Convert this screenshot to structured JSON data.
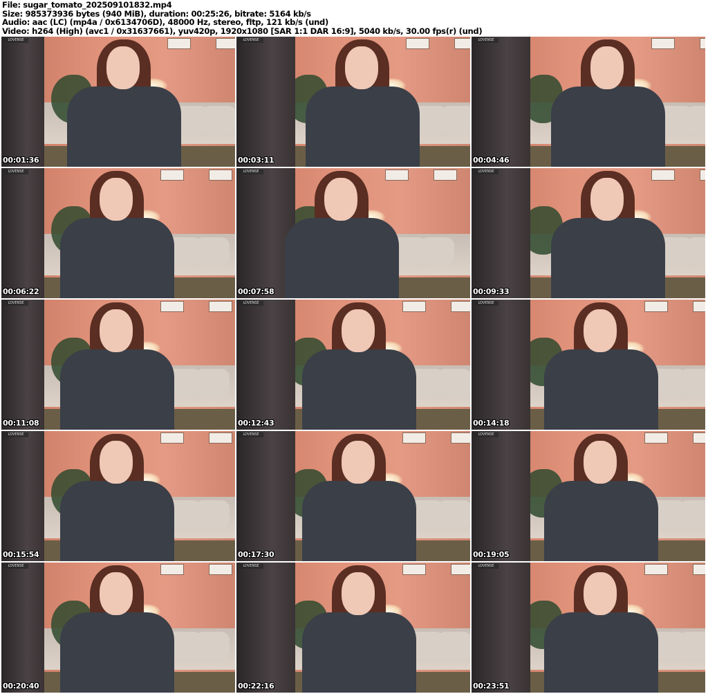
{
  "header": {
    "file": "File: sugar_tomato_202509101832.mp4",
    "size": "Size: 985373936 bytes (940 MiB), duration: 00:25:26, bitrate: 5164 kb/s",
    "audio": "Audio: aac (LC) (mp4a / 0x6134706D), 48000 Hz, stereo, fltp, 121 kb/s (und)",
    "video": "Video: h264 (High) (avc1 / 0x31637661), yuv420p, 1920x1080 [SAR 1:1 DAR 16:9], 5040 kb/s, 30.00 fps(r) (und)"
  },
  "watermark": "LOVENSE",
  "thumbnails": [
    {
      "timestamp": "00:01:36"
    },
    {
      "timestamp": "00:03:11"
    },
    {
      "timestamp": "00:04:46"
    },
    {
      "timestamp": "00:06:22"
    },
    {
      "timestamp": "00:07:58"
    },
    {
      "timestamp": "00:09:33"
    },
    {
      "timestamp": "00:11:08"
    },
    {
      "timestamp": "00:12:43"
    },
    {
      "timestamp": "00:14:18"
    },
    {
      "timestamp": "00:15:54"
    },
    {
      "timestamp": "00:17:30"
    },
    {
      "timestamp": "00:19:05"
    },
    {
      "timestamp": "00:20:40"
    },
    {
      "timestamp": "00:22:16"
    },
    {
      "timestamp": "00:23:51"
    }
  ]
}
